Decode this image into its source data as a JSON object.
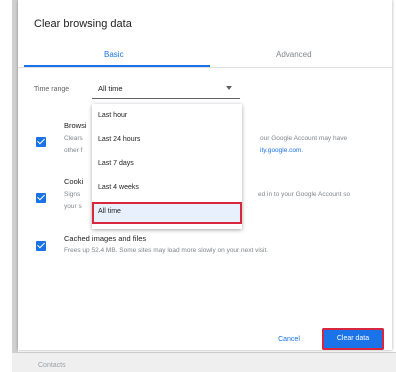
{
  "dialog": {
    "title": "Clear browsing data",
    "tabs": [
      {
        "label": "Basic",
        "active": true
      },
      {
        "label": "Advanced",
        "active": false
      }
    ],
    "time_range": {
      "label": "Time range",
      "value": "All time"
    },
    "options": [
      {
        "title": "Browsi",
        "desc1": "Clears",
        "desc1_right": "our Google Account may have",
        "desc2": "other f",
        "desc2_right": "ity.google.com.",
        "checked": true
      },
      {
        "title": "Cooki",
        "desc1": "Signs",
        "desc1_right": "ed in to your Google Account so",
        "desc2": "your s",
        "checked": true
      },
      {
        "title": "Cached images and files",
        "desc1": "Frees up 52.4 MB. Some sites may load more slowly on your next visit.",
        "checked": true
      }
    ],
    "dropdown_options": [
      {
        "label": "Last hour",
        "selected": false
      },
      {
        "label": "Last 24 hours",
        "selected": false
      },
      {
        "label": "Last 7 days",
        "selected": false
      },
      {
        "label": "Last 4 weeks",
        "selected": false
      },
      {
        "label": "All time",
        "selected": true
      }
    ],
    "buttons": {
      "cancel": "Cancel",
      "clear": "Clear data"
    }
  },
  "background": {
    "bottom_text": "Contacts"
  },
  "colors": {
    "accent": "#1a73e8",
    "highlight": "#d7263d"
  }
}
